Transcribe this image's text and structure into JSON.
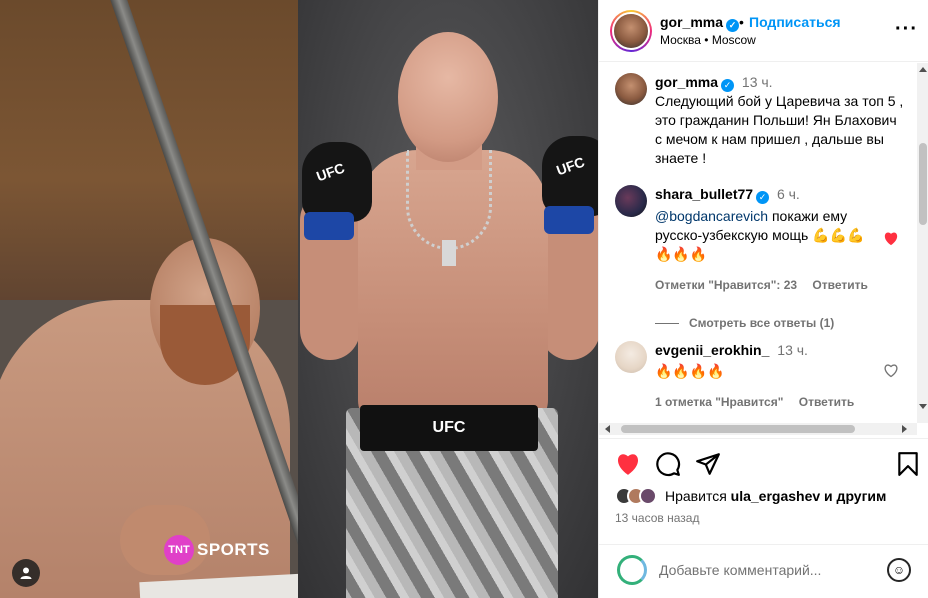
{
  "media": {
    "tnt_badge": "TNT",
    "tnt_sports": "SPORTS",
    "glove_label": "UFC",
    "waistband_label": "UFC"
  },
  "header": {
    "username": "gor_mma",
    "dot": "•",
    "follow_label": "Подписаться",
    "location": "Москва • Moscow",
    "more": "···"
  },
  "caption": {
    "username": "gor_mma",
    "time": "13 ч.",
    "text": "Следующий бой у Царевича за топ 5 , это гражданин Польши! Ян Блахович с мечом к нам пришел , дальше вы знаете !"
  },
  "comments": [
    {
      "username": "shara_bullet77",
      "time": "6 ч.",
      "mention": "@bogdancarevich",
      "text": " покажи ему русско-узбекскую мощь 💪💪💪🔥🔥🔥",
      "likes_label": "Отметки \"Нравится\": 23",
      "reply_label": "Ответить",
      "view_replies": "Смотреть все ответы (1)"
    },
    {
      "username": "evgenii_erokhin_",
      "time": "13 ч.",
      "text": "🔥🔥🔥🔥",
      "likes_label": "1 отметка \"Нравится\"",
      "reply_label": "Ответить"
    }
  ],
  "likes": {
    "prefix": "Нравится ",
    "user": "ula_ergashev",
    "suffix": " и другим"
  },
  "post_time": "13 часов назад",
  "add_comment": {
    "placeholder": "Добавьте комментарий..."
  },
  "colors": {
    "accent": "#0095f6",
    "like_red": "#ff3040"
  }
}
